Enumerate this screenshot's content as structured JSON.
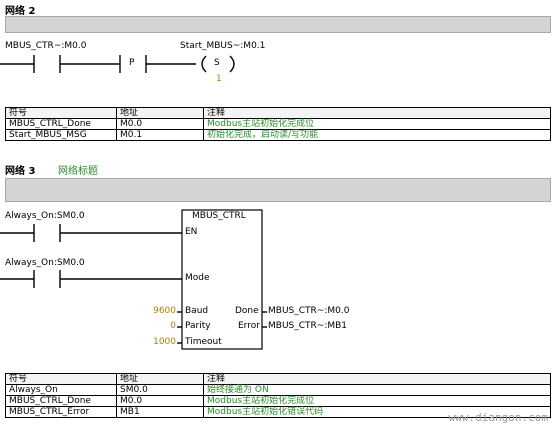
{
  "network2": {
    "title": "网络 2",
    "contacts": {
      "left_label": "MBUS_CTR~:M0.0",
      "p_label": "P",
      "coil_label": "Start_MBUS~:M0.1",
      "coil_symbol": "S",
      "coil_count": "1"
    },
    "symbol_table": {
      "headers": [
        "符号",
        "地址",
        "注释"
      ],
      "rows": [
        [
          "MBUS_CTRL_Done",
          "M0.0",
          "Modbus主站初始化完成位"
        ],
        [
          "Start_MBUS_MSG",
          "M0.1",
          "初始化完成，启动读/写功能"
        ]
      ]
    }
  },
  "network3": {
    "title": "网络 3",
    "subtitle": "网络标题",
    "contacts": {
      "en_contact_label": "Always_On:SM0.0",
      "mode_contact_label": "Always_On:SM0.0"
    },
    "block": {
      "name": "MBUS_CTRL",
      "en": "EN",
      "mode": "Mode",
      "baud_pin": "Baud",
      "parity_pin": "Parity",
      "timeout_pin": "Timeout",
      "done_pin": "Done",
      "error_pin": "Error",
      "baud_value": "9600",
      "parity_value": "0",
      "timeout_value": "1000",
      "done_output": "MBUS_CTR~:M0.0",
      "error_output": "MBUS_CTR~:MB1"
    },
    "symbol_table": {
      "headers": [
        "符号",
        "地址",
        "注释"
      ],
      "rows": [
        [
          "Always_On",
          "SM0.0",
          "始终接通为 ON"
        ],
        [
          "MBUS_CTRL_Done",
          "M0.0",
          "Modbus主站初始化完成位"
        ],
        [
          "MBUS_CTRL_Error",
          "MB1",
          "Modbus主站初始化错误代码"
        ]
      ]
    }
  },
  "watermark": "www.diangon.com",
  "colors": {
    "comment_green": "#2a8a2a",
    "value_orange": "#b08000",
    "comment_bar": "#d4d4d4"
  }
}
